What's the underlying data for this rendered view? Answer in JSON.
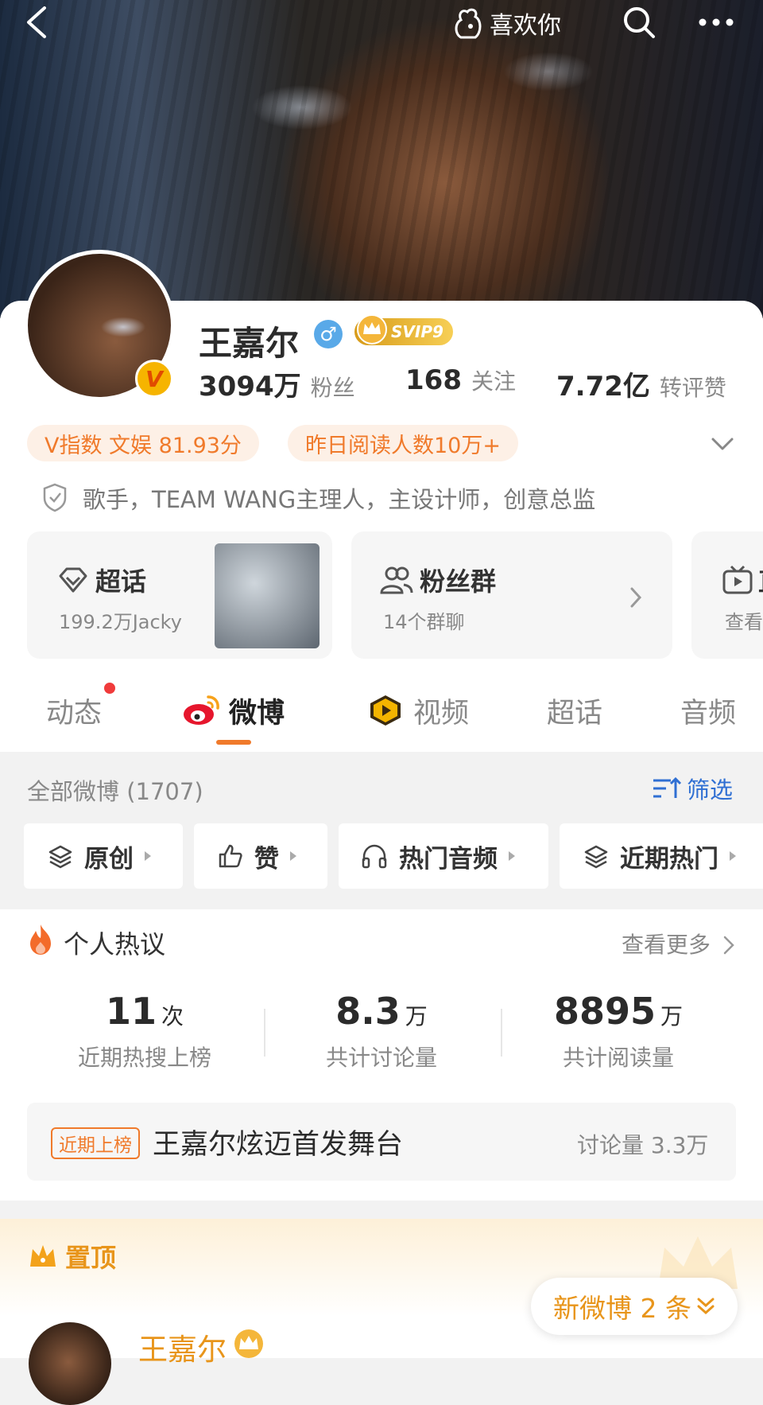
{
  "header": {
    "like_label": "喜欢你"
  },
  "profile": {
    "name": "王嘉尔",
    "gender_symbol": "♂",
    "vip_badge": "SVIP9",
    "verified_badge": "V",
    "stats": [
      {
        "value": "3094万",
        "label": "粉丝"
      },
      {
        "value": "168",
        "label": "关注"
      },
      {
        "value": "7.72亿",
        "label": "转评赞"
      }
    ],
    "chips": [
      "V指数 文娱 81.93分",
      "昨日阅读人数10万+"
    ],
    "bio": "歌手，TEAM WANG主理人，主设计师，创意总监"
  },
  "tiles": [
    {
      "title": "超话",
      "subtitle": "199.2万Jacky"
    },
    {
      "title": "粉丝群",
      "subtitle": "14个群聊"
    },
    {
      "title": "直",
      "subtitle": "查看"
    }
  ],
  "tabs": [
    "动态",
    "微博",
    "视频",
    "超话",
    "音频"
  ],
  "filters": {
    "all_count": "全部微博 (1707)",
    "filter_label": "筛选",
    "buttons": [
      "原创",
      "赞",
      "热门音频",
      "近期热门"
    ]
  },
  "hot": {
    "title": "个人热议",
    "more": "查看更多",
    "metrics": [
      {
        "value": "11",
        "unit": "次",
        "caption": "近期热搜上榜"
      },
      {
        "value": "8.3",
        "unit": "万",
        "caption": "共计讨论量"
      },
      {
        "value": "8895",
        "unit": "万",
        "caption": "共计阅读量"
      }
    ],
    "trend_tag": "近期上榜",
    "trend_text": "王嘉尔炫迈首发舞台",
    "trend_count": "讨论量 3.3万"
  },
  "pinned": {
    "label": "置顶",
    "new_posts": "新微博 2 条",
    "post_author": "王嘉尔"
  },
  "colors": {
    "accent_orange": "#f07a2b",
    "link_blue": "#2f6fd3",
    "gold": "#e8951b"
  }
}
